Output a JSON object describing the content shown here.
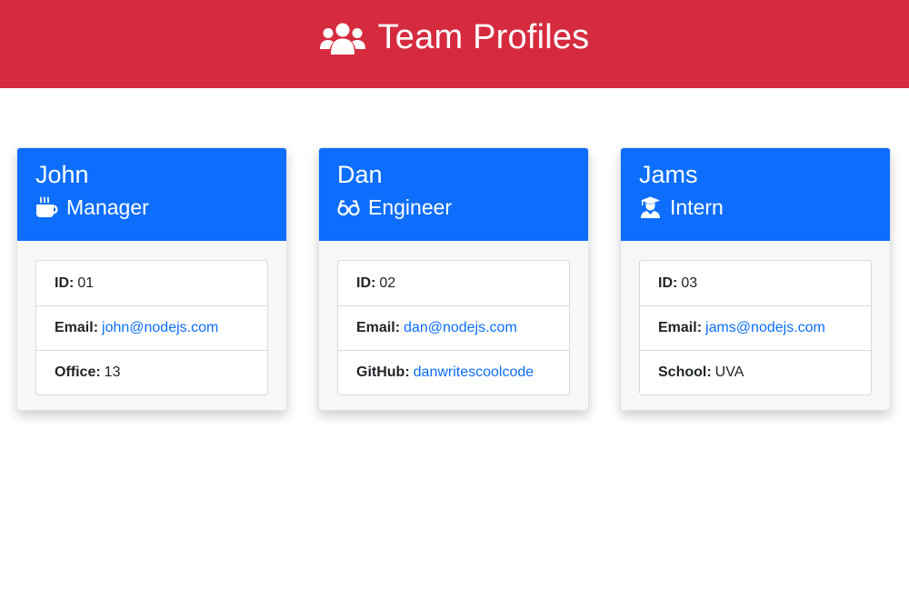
{
  "header": {
    "title": "Team Profiles",
    "icon": "users-icon",
    "background": "#d62b3f"
  },
  "accent": "#0d6efd",
  "cards": [
    {
      "name": "John",
      "role": "Manager",
      "role_icon": "coffee-mug-icon",
      "id_label": "ID:",
      "id": "01",
      "email_label": "Email:",
      "email": "john@nodejs.com",
      "extra_label": "Office:",
      "extra": "13"
    },
    {
      "name": "Dan",
      "role": "Engineer",
      "role_icon": "glasses-icon",
      "id_label": "ID:",
      "id": "02",
      "email_label": "Email:",
      "email": "dan@nodejs.com",
      "extra_label": "GitHub:",
      "extra": "danwritescoolcode"
    },
    {
      "name": "Jams",
      "role": "Intern",
      "role_icon": "graduate-icon",
      "id_label": "ID:",
      "id": "03",
      "email_label": "Email:",
      "email": "jams@nodejs.com",
      "extra_label": "School:",
      "extra": "UVA"
    }
  ]
}
